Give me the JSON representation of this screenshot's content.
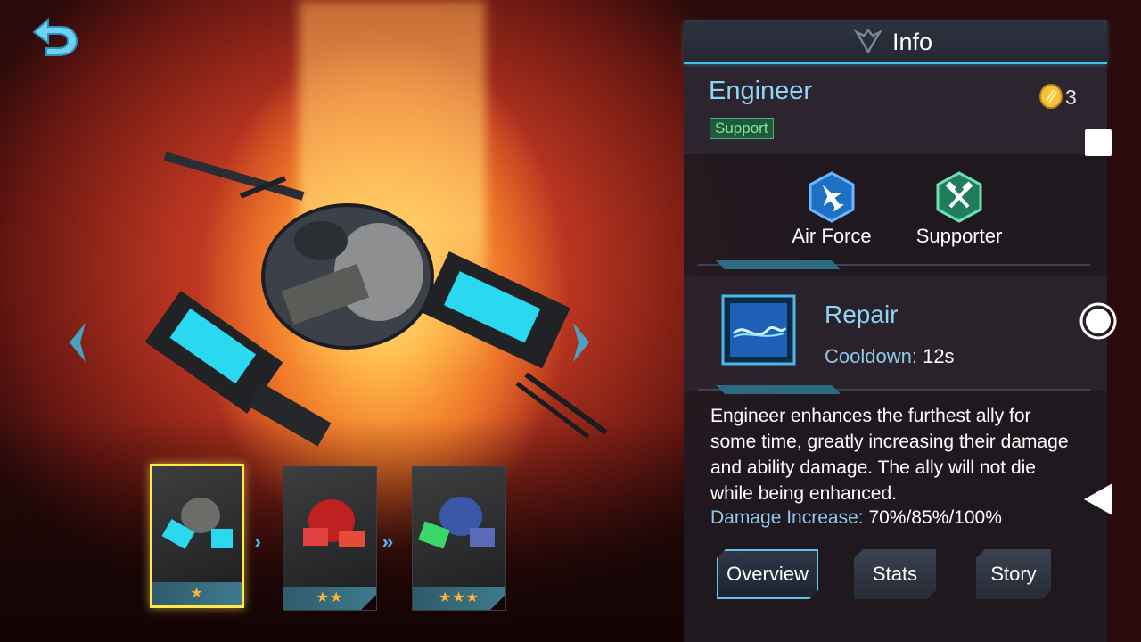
{
  "nav": {
    "back_icon": "back-arrow-icon",
    "prev_icon": "chevron-left-icon",
    "next_icon": "chevron-right-icon"
  },
  "cards": [
    {
      "stars": "★",
      "selected": true
    },
    {
      "stars": "★★",
      "selected": false
    },
    {
      "stars": "★★★",
      "selected": false
    }
  ],
  "panel": {
    "title": "Info",
    "hero_name": "Engineer",
    "role": "Support",
    "cost": "3",
    "traits": [
      {
        "label": "Air Force",
        "icon": "jet-icon",
        "color": "#2a7fd4"
      },
      {
        "label": "Supporter",
        "icon": "hammer-wrench-icon",
        "color": "#2fa37a"
      }
    ],
    "skill": {
      "name": "Repair",
      "cooldown_label": "Cooldown:",
      "cooldown_value": "12s"
    },
    "description": "Engineer enhances the furthest ally for some time, greatly increasing their damage and ability damage. The ally will not die while being enhanced.",
    "stat_label": "Damage Increase:",
    "stat_value": "70%/85%/100%",
    "tabs": [
      "Overview",
      "Stats",
      "Story"
    ],
    "active_tab": "Overview"
  },
  "colors": {
    "accent": "#3fc4ee",
    "name": "#8fd3f5",
    "selected_card": "#ffe84a",
    "star": "#ffb23a"
  }
}
